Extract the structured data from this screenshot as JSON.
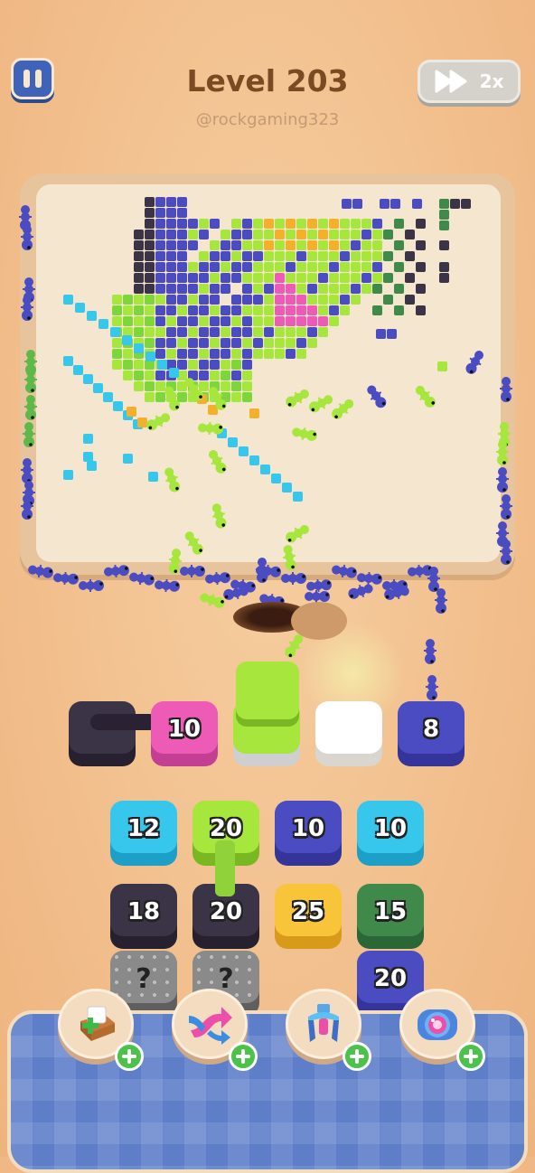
{
  "header": {
    "level_title": "Level 203",
    "watermark": "@rockgaming323",
    "speed_label": "2x"
  },
  "colors": {
    "purple": "#4b4bc2",
    "lime": "#a6e63d",
    "green": "#3f8a4a",
    "dark": "#3b3346",
    "cyan": "#38c7ec",
    "pink": "#ee5bb7",
    "orange": "#f4b02a",
    "yellow": "#f7c43a"
  },
  "queue": [
    {
      "color": "dark",
      "count": ""
    },
    {
      "color": "pink",
      "count": "10"
    },
    {
      "color": "lime-active",
      "count": ""
    },
    {
      "color": "empty",
      "count": ""
    },
    {
      "color": "purple",
      "count": "8"
    }
  ],
  "grid": [
    [
      {
        "color": "cyan",
        "count": "12"
      },
      {
        "color": "lime",
        "count": "20"
      },
      {
        "color": "purple",
        "count": "10"
      },
      {
        "color": "cyan",
        "count": "10"
      }
    ],
    [
      {
        "color": "dark",
        "count": "18"
      },
      {
        "color": "dark",
        "count": "20"
      },
      {
        "color": "yellow",
        "count": "25"
      },
      {
        "color": "green",
        "count": "15"
      }
    ],
    [
      {
        "color": "mystery",
        "count": "?"
      },
      {
        "color": "mystery",
        "count": "?"
      },
      null,
      {
        "color": "purple",
        "count": "20"
      }
    ]
  ],
  "boosters": [
    {
      "icon": "add-tile-icon"
    },
    {
      "icon": "shuffle-icon"
    },
    {
      "icon": "magnet-claw-icon"
    },
    {
      "icon": "vacuum-icon"
    }
  ]
}
